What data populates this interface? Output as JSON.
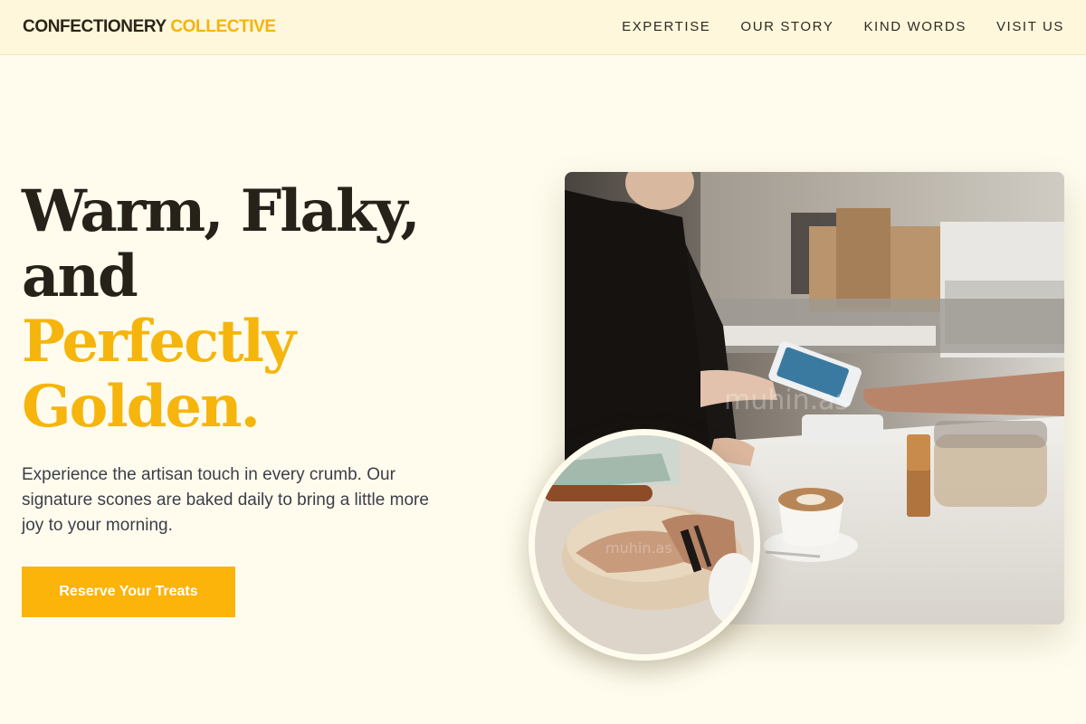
{
  "brand": {
    "name_part1": "CONFECTIONERY",
    "name_part2": "COLLECTIVE"
  },
  "nav": {
    "items": [
      "EXPERTISE",
      "OUR STORY",
      "KIND WORDS",
      "VISIT US"
    ]
  },
  "hero": {
    "headline_line1": "Warm, Flaky,",
    "headline_line2": "and",
    "headline_line3": "Perfectly",
    "headline_line4": "Golden.",
    "description": "Experience the artisan touch in every crumb. Our signature scones are baked daily to bring a little more joy to your morning.",
    "cta_label": "Reserve Your Treats"
  },
  "images": {
    "main": "cafe-payment-photo",
    "secondary": "dough-kneading-photo",
    "watermark": "muhin.as"
  },
  "colors": {
    "accent": "#fcb40a",
    "background": "#fffcee",
    "header_bg": "#fff7dc",
    "text_dark": "#26221a"
  }
}
